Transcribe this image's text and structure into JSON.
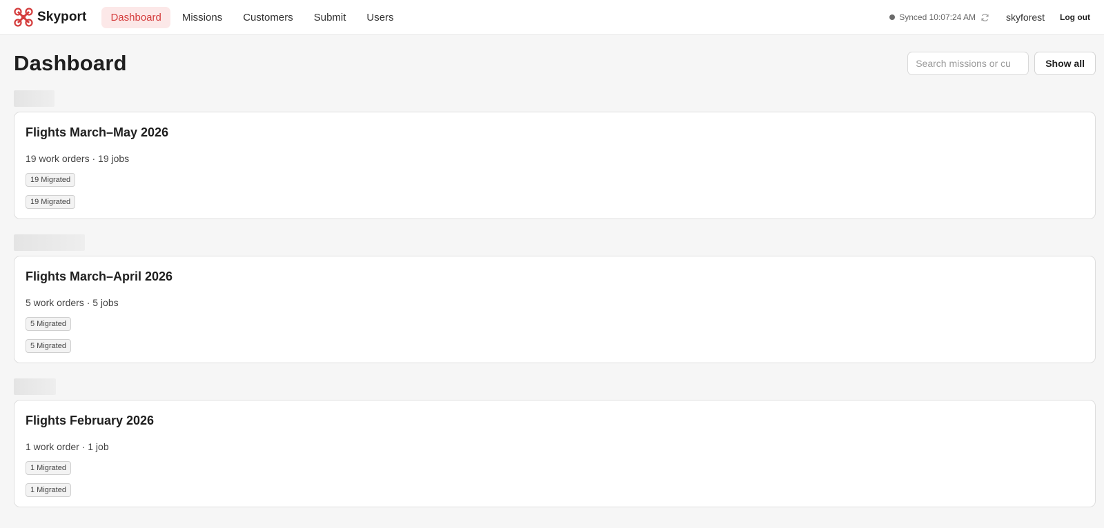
{
  "app": {
    "name": "Skyport"
  },
  "nav": {
    "items": [
      {
        "label": "Dashboard",
        "active": true
      },
      {
        "label": "Missions"
      },
      {
        "label": "Customers"
      },
      {
        "label": "Submit"
      },
      {
        "label": "Users"
      }
    ]
  },
  "status": {
    "sync_text": "Synced 10:07:24 AM",
    "username": "skyforest",
    "logout_label": "Log out"
  },
  "page": {
    "title": "Dashboard",
    "search_placeholder": "Search missions or cu",
    "show_all_label": "Show all"
  },
  "groups": [
    {
      "card": {
        "title": "Flights March–May 2026",
        "meta": "19 work orders · 19 jobs",
        "badges": [
          "19 Migrated",
          "19 Migrated"
        ]
      }
    },
    {
      "card": {
        "title": "Flights March–April 2026",
        "meta": "5 work orders · 5 jobs",
        "badges": [
          "5 Migrated",
          "5 Migrated"
        ]
      }
    },
    {
      "card": {
        "title": "Flights February 2026",
        "meta": "1 work order · 1 job",
        "badges": [
          "1 Migrated",
          "1 Migrated"
        ]
      }
    }
  ],
  "colors": {
    "accent": "#d43c3c",
    "accent_bg": "#fce8e8",
    "page_bg": "#f6f6f6"
  }
}
